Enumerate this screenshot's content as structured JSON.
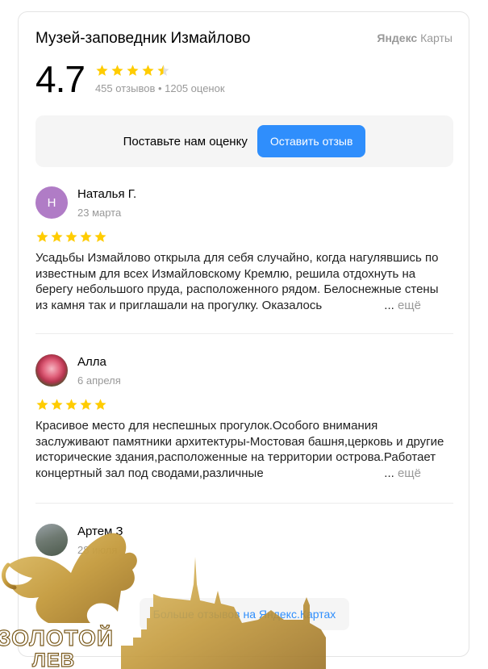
{
  "widget": {
    "title": "Музей-заповедник Измайлово",
    "brand_bold": "Яндекс",
    "brand_rest": " Карты",
    "rating": "4.7",
    "reviews_count": "455 отзывов",
    "ratings_count": "1205 оценок",
    "rating_stars": 4.5,
    "star_color": "#fc0",
    "accent_color": "#2f8efc"
  },
  "cta": {
    "text": "Поставьте нам оценку",
    "button": "Оставить отзыв"
  },
  "reviews": [
    {
      "author": "Наталья Г.",
      "initial": "Н",
      "avatar_color": "#b07cc6",
      "date": "23 марта",
      "stars": 5,
      "text": "Усадьбы Измайлово открыла для себя случайно, когда нагулявшись по известным для всех Измайловскому Кремлю, решила отдохнуть на берегу небольшого пруда, расположенного рядом. Белоснежные стены из камня так и приглашали на прогулку. Оказалось"
    },
    {
      "author": "Алла",
      "date": "6 апреля",
      "stars": 5,
      "text": "Красивое место для неспешных прогулок.Особого внимания заслуживают памятники архитектуры-Мостовая башня,церковь и другие исторические здания,расположенные на территории острова.Работает концертный зал под сводами,различные"
    },
    {
      "author": "Артем З",
      "date": "28 июля"
    }
  ],
  "more_label": "ещё",
  "more_dots": "...",
  "footer": {
    "more_reviews": "Больше отзывов на Яндекс.Картах"
  },
  "watermark": {
    "line1": "ЗОЛОТОЙ",
    "line2": "ЛЕВ",
    "color": "#c9a44a"
  }
}
